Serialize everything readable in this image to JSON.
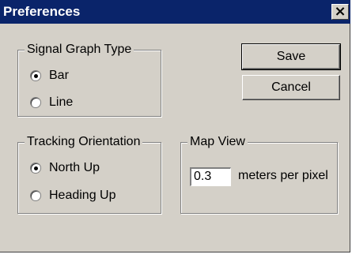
{
  "window": {
    "title": "Preferences",
    "close_glyph": "×"
  },
  "signal_graph": {
    "title": "Signal Graph Type",
    "options": [
      {
        "label": "Bar",
        "checked": true
      },
      {
        "label": "Line",
        "checked": false
      }
    ]
  },
  "tracking": {
    "title": "Tracking Orientation",
    "options": [
      {
        "label": "North Up",
        "checked": true
      },
      {
        "label": "Heading Up",
        "checked": false
      }
    ]
  },
  "map_view": {
    "title": "Map View",
    "value": "0.3",
    "units": "meters per pixel"
  },
  "buttons": {
    "save": "Save",
    "cancel": "Cancel"
  },
  "colors": {
    "titlebar": "#0a246a",
    "face": "#d4d0c8"
  }
}
